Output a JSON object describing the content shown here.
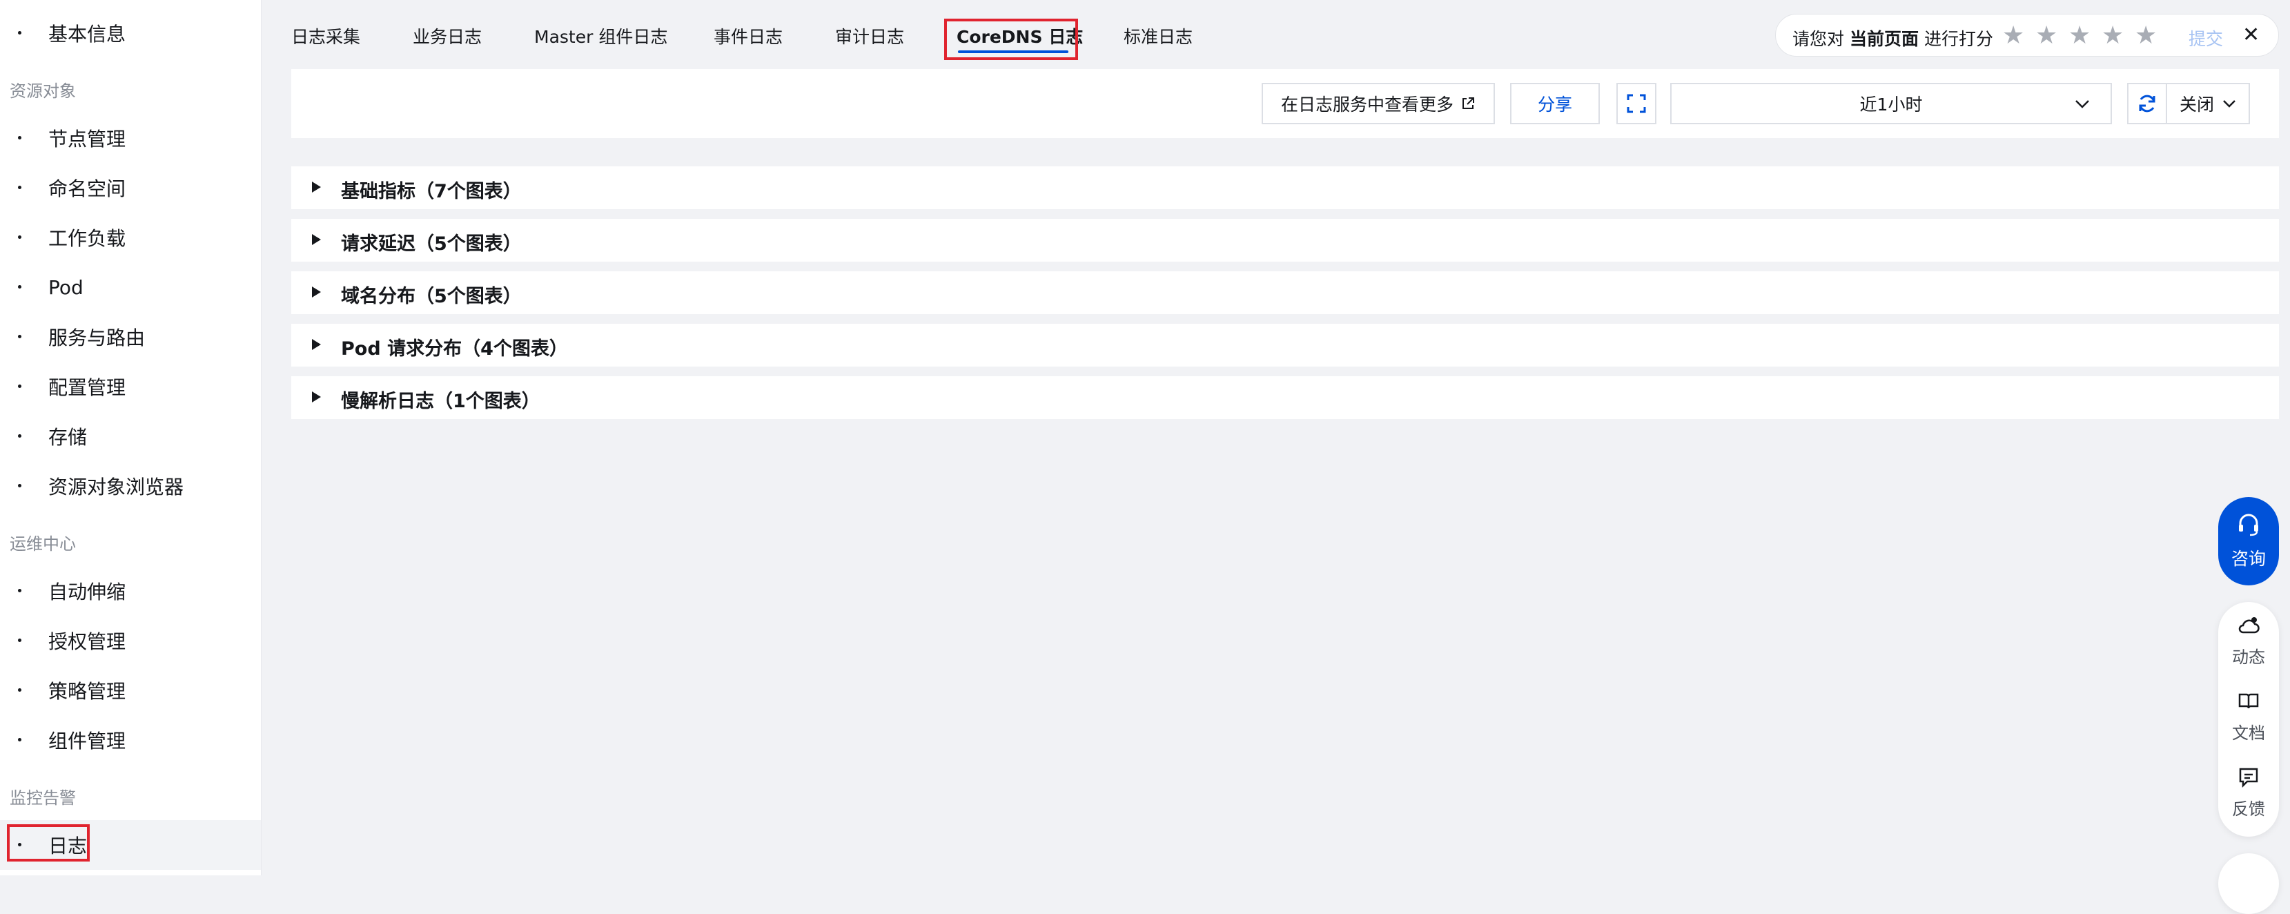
{
  "sidebar": {
    "top_item": "基本信息",
    "groups": [
      {
        "title": "资源对象",
        "items": [
          "节点管理",
          "命名空间",
          "工作负载",
          "Pod",
          "服务与路由",
          "配置管理",
          "存储",
          "资源对象浏览器"
        ]
      },
      {
        "title": "运维中心",
        "items": [
          "自动伸缩",
          "授权管理",
          "策略管理",
          "组件管理"
        ]
      },
      {
        "title": "监控告警",
        "items": [
          "日志"
        ]
      }
    ],
    "active_item": "日志"
  },
  "tabs": [
    "日志采集",
    "业务日志",
    "Master 组件日志",
    "事件日志",
    "审计日志",
    "CoreDNS 日志",
    "标准日志"
  ],
  "active_tab": "CoreDNS 日志",
  "rating": {
    "prefix": "请您对",
    "bold": "当前页面",
    "suffix": "进行打分",
    "stars": 5,
    "submit": "提交",
    "close_icon": "close-icon"
  },
  "toolbar": {
    "view_more": "在日志服务中查看更多",
    "share": "分享",
    "time_range": "近1小时",
    "auto_refresh": "关闭"
  },
  "sections": [
    "基础指标（7个图表）",
    "请求延迟（5个图表）",
    "域名分布（5个图表）",
    "Pod 请求分布（4个图表）",
    "慢解析日志（1个图表）"
  ],
  "float": {
    "consult": "咨询",
    "items": [
      "动态",
      "文档",
      "反馈"
    ]
  },
  "colors": {
    "accent": "#0052d9",
    "highlight": "#e0242f",
    "background": "#f1f2f5"
  }
}
